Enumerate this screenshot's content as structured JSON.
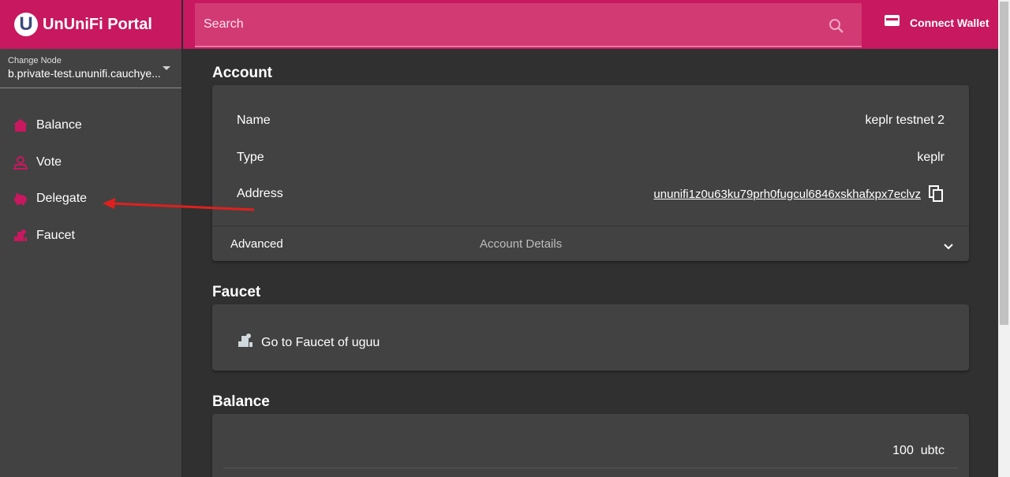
{
  "brand": {
    "logo_letter": "U",
    "title": "UnUniFi Portal"
  },
  "node": {
    "label": "Change Node",
    "value": "b.private-test.ununifi.cauchye...."
  },
  "sidebar": {
    "items": [
      {
        "label": "Balance",
        "icon": "home-icon"
      },
      {
        "label": "Vote",
        "icon": "vote-icon"
      },
      {
        "label": "Delegate",
        "icon": "piggy-bank-icon"
      },
      {
        "label": "Faucet",
        "icon": "faucet-icon"
      }
    ]
  },
  "search": {
    "placeholder": "Search"
  },
  "wallet": {
    "label": "Connect Wallet"
  },
  "account": {
    "title": "Account",
    "name_label": "Name",
    "name_value": "keplr testnet 2",
    "type_label": "Type",
    "type_value": "keplr",
    "address_label": "Address",
    "address_value": "ununifi1z0u63ku79prh0fugcul6846xskhafxpx7eclvz",
    "advanced_label": "Advanced",
    "advanced_desc": "Account Details"
  },
  "faucet": {
    "title": "Faucet",
    "link_label": "Go to Faucet of uguu"
  },
  "balance": {
    "title": "Balance",
    "amount": "100",
    "denom": "ubtc"
  },
  "colors": {
    "accent": "#c8185f",
    "sidebar_bg": "#424242",
    "page_bg": "#303030",
    "card_bg": "#424242",
    "annotation_arrow": "#e0201e"
  }
}
